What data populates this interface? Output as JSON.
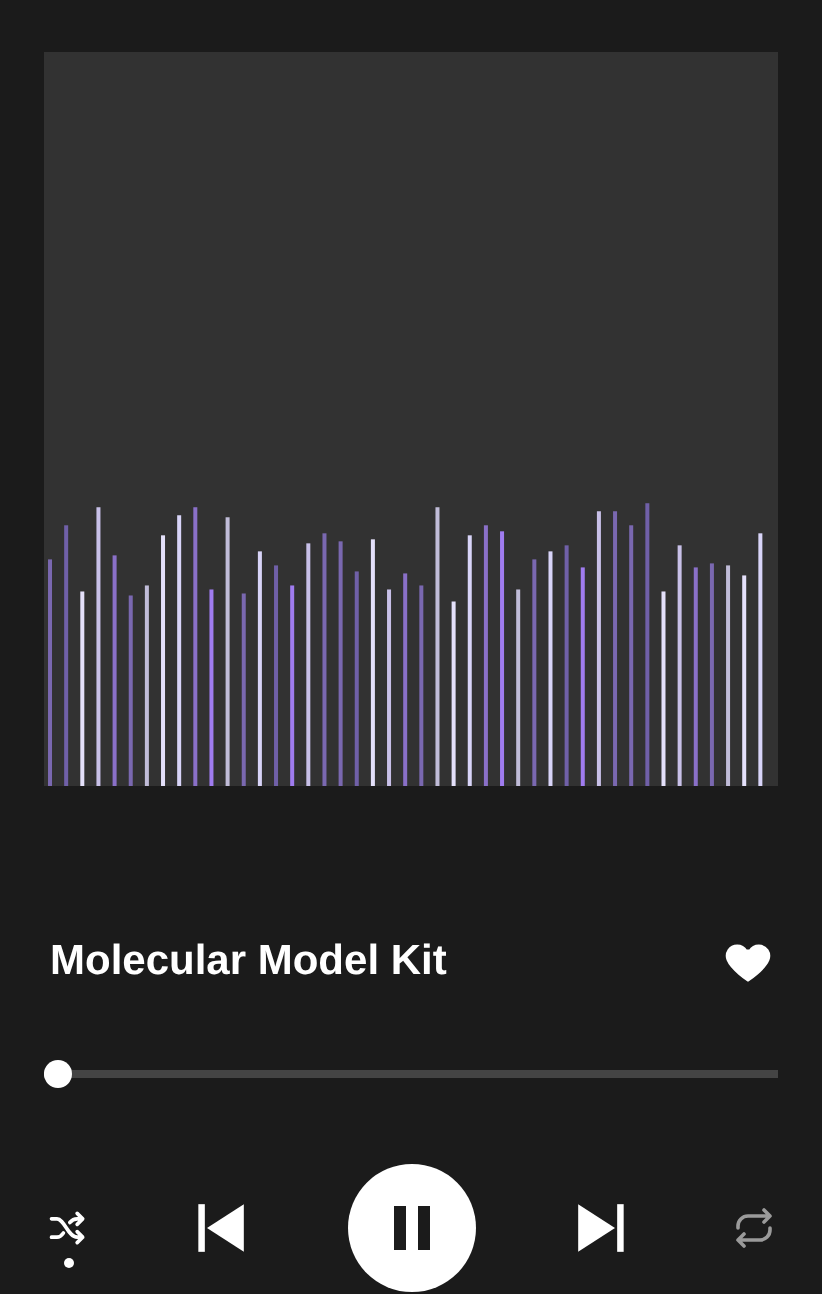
{
  "track": {
    "title": "Molecular Model Kit",
    "liked": true
  },
  "progress": {
    "level": 0.02
  },
  "controls": {
    "shuffle": true,
    "playing": true,
    "repeat": false
  }
}
